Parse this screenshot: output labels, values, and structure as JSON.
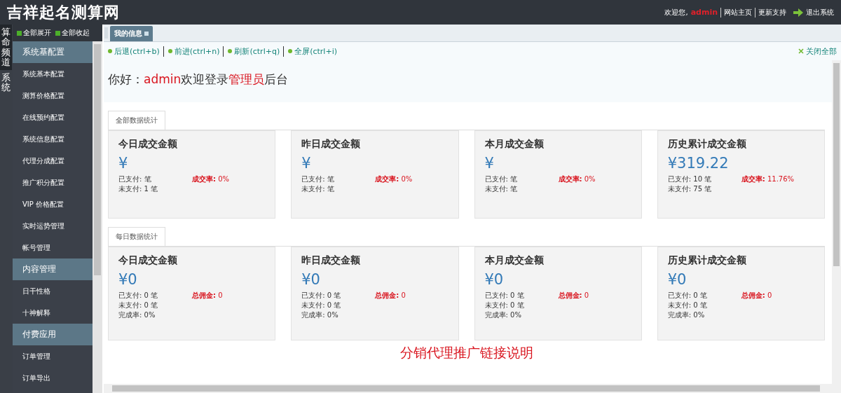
{
  "header": {
    "title": "吉祥起名测算网",
    "welcome": "欢迎您,",
    "user": "admin",
    "links": [
      "网站主页",
      "更新支持"
    ],
    "logout": "退出系统"
  },
  "channels": [
    {
      "label": "算命频道",
      "selected": true
    },
    {
      "label": "系统",
      "selected": false
    }
  ],
  "sidebar": {
    "expand_all": "全部展开",
    "collapse_all": "全部收起",
    "groups": [
      {
        "title": "系统基配置",
        "items": [
          "系统基本配置",
          "测算价格配置",
          "在线预约配置",
          "系统信息配置",
          "代理分成配置",
          "推广积分配置",
          "VIP 价格配置",
          "实时运势管理",
          "帐号管理"
        ]
      },
      {
        "title": "内容管理",
        "items": [
          "日干性格",
          "十神解释"
        ]
      },
      {
        "title": "付费应用",
        "items": [
          "订单管理",
          "订单导出"
        ]
      }
    ]
  },
  "tabs": [
    {
      "label": "我的信息",
      "selected": true
    }
  ],
  "toolbar": {
    "actions": [
      "后退(ctrl+b)",
      "前进(ctrl+n)",
      "刷新(ctrl+q)",
      "全屏(ctrl+i)"
    ],
    "close_all": "关闭全部"
  },
  "greeting": [
    {
      "text": "你好：",
      "kind": "plain"
    },
    {
      "text": "admin",
      "kind": "highlight"
    },
    {
      "text": "欢迎登录",
      "kind": "plain"
    },
    {
      "text": "管理员",
      "kind": "highlight"
    },
    {
      "text": "后台",
      "kind": "plain"
    }
  ],
  "sections": [
    {
      "tab": "全部数据统计",
      "cards": [
        {
          "title": "今日成交金额",
          "amount": "¥",
          "lines": [
            "已支付: 笔",
            "未支付: 1 笔"
          ],
          "side_label": "成交率:",
          "side_value": "0%"
        },
        {
          "title": "昨日成交金额",
          "amount": "¥",
          "lines": [
            "已支付: 笔",
            "未支付: 笔"
          ],
          "side_label": "成交率:",
          "side_value": "0%"
        },
        {
          "title": "本月成交金额",
          "amount": "¥",
          "lines": [
            "已支付: 笔",
            "未支付: 笔"
          ],
          "side_label": "成交率:",
          "side_value": "0%"
        },
        {
          "title": "历史累计成交金额",
          "amount": "¥319.22",
          "lines": [
            "已支付: 10 笔",
            "未支付: 75 笔"
          ],
          "side_label": "成交率:",
          "side_value": "11.76%"
        }
      ]
    },
    {
      "tab": "每日数据统计",
      "cards": [
        {
          "title": "今日成交金额",
          "amount": "¥0",
          "lines": [
            "已支付: 0 笔",
            "未支付: 0 笔",
            "完成率: 0%"
          ],
          "side_label": "总佣金:",
          "side_value": "0"
        },
        {
          "title": "昨日成交金额",
          "amount": "¥0",
          "lines": [
            "已支付: 0 笔",
            "未支付: 0 笔",
            "完成率: 0%"
          ],
          "side_label": "总佣金:",
          "side_value": "0"
        },
        {
          "title": "本月成交金额",
          "amount": "¥0",
          "lines": [
            "已支付: 0 笔",
            "未支付: 0 笔",
            "完成率: 0%"
          ],
          "side_label": "总佣金:",
          "side_value": "0"
        },
        {
          "title": "历史累计成交金额",
          "amount": "¥0",
          "lines": [
            "已支付: 0 笔",
            "未支付: 0 笔",
            "完成率: 0%"
          ],
          "side_label": "总佣金:",
          "side_value": "0"
        }
      ]
    }
  ],
  "footer_heading": "分销代理推广链接说明"
}
